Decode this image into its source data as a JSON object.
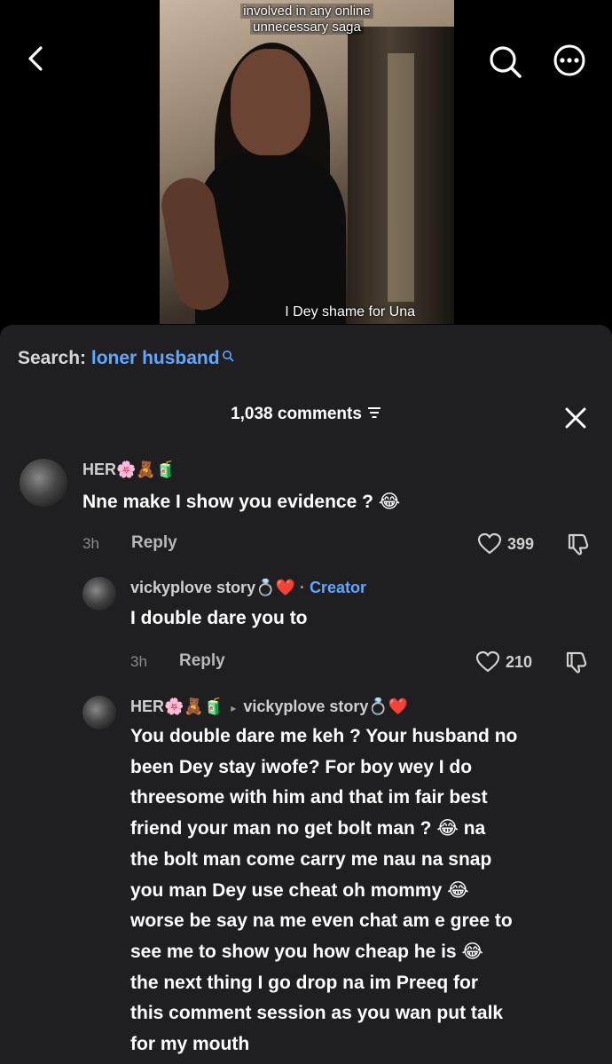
{
  "video": {
    "overlay_line1": "involved in any online",
    "overlay_line2": "unnecessary saga",
    "caption": "I Dey shame for Una"
  },
  "nav": {
    "back_icon": "chevron-left-icon",
    "search_icon": "search-icon",
    "more_icon": "more-icon"
  },
  "search": {
    "label": "Search:",
    "term": "loner husband"
  },
  "comments": {
    "count_label": "1,038 comments",
    "items": [
      {
        "username": "HER🌸🧸🧃",
        "text": "Nne make I show you evidence ? 😂",
        "time": "3h",
        "reply": "Reply",
        "likes": "399"
      },
      {
        "username": "vickyplove story💍❤️",
        "creator_sep": "·",
        "creator": "Creator",
        "text": "I double dare you to",
        "time": "3h",
        "reply": "Reply",
        "likes": "210"
      },
      {
        "username": "HER🌸🧸🧃",
        "reply_to": "vickyplove story💍❤️",
        "lines": [
          "You double dare me keh ? Your husband no",
          "been Dey stay iwofe? For boy wey I do",
          "threesome with him and that im fair best",
          "friend your man no get bolt man ? 😂 na",
          "the bolt man come carry me nau na snap",
          "you man Dey use cheat oh mommy 😂",
          "worse be say na me even chat am e gree to",
          "see me to show you how cheap he is 😂",
          "the next thing I go drop na im Preeq for",
          "this comment session as you wan put talk",
          "for my mouth"
        ]
      }
    ]
  },
  "colors": {
    "sheet_bg": "#1f1e21",
    "accent_blue": "#5fa8ff",
    "muted": "#8b8b8b"
  }
}
